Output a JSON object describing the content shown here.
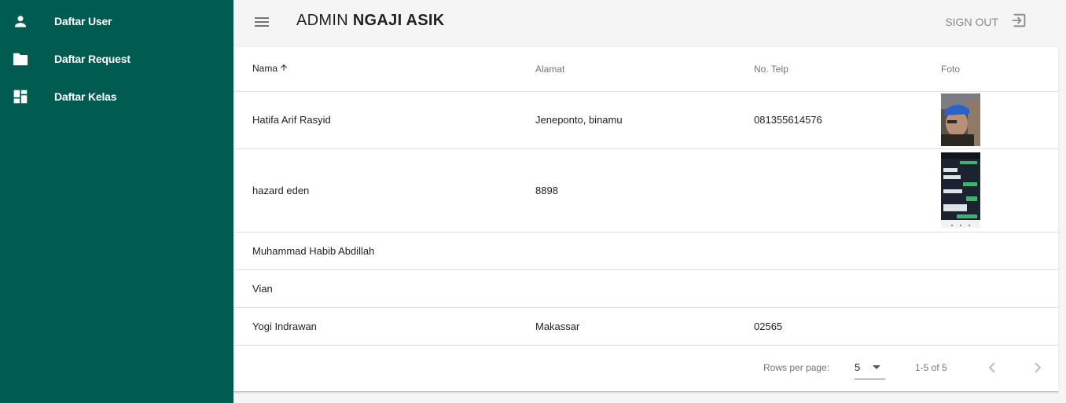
{
  "sidebar": {
    "items": [
      {
        "label": "Daftar User",
        "icon": "person-icon"
      },
      {
        "label": "Daftar Request",
        "icon": "folder-icon"
      },
      {
        "label": "Daftar Kelas",
        "icon": "dashboard-icon"
      }
    ],
    "background": "#005c50"
  },
  "header": {
    "title_prefix": "ADMIN",
    "title_bold": "NGAJI ASIK",
    "signout_label": "SIGN OUT"
  },
  "table": {
    "columns": [
      "Nama",
      "Alamat",
      "No. Telp",
      "Foto"
    ],
    "sorted_column": "Nama",
    "sort_direction": "ascending",
    "rows": [
      {
        "nama": "Hatifa Arif Rasyid",
        "alamat": "Jeneponto, binamu",
        "telp": "081355614576",
        "foto": "person-photo"
      },
      {
        "nama": "hazard eden",
        "alamat": "8898",
        "telp": "",
        "foto": "chat-screenshot-photo"
      },
      {
        "nama": "Muhammad Habib Abdillah",
        "alamat": "",
        "telp": "",
        "foto": ""
      },
      {
        "nama": "Vian",
        "alamat": "",
        "telp": "",
        "foto": ""
      },
      {
        "nama": "Yogi Indrawan",
        "alamat": "Makassar",
        "telp": "02565",
        "foto": ""
      }
    ]
  },
  "pagination": {
    "rows_per_page_label": "Rows per page:",
    "rows_per_page": "5",
    "range": "1-5 of 5"
  }
}
